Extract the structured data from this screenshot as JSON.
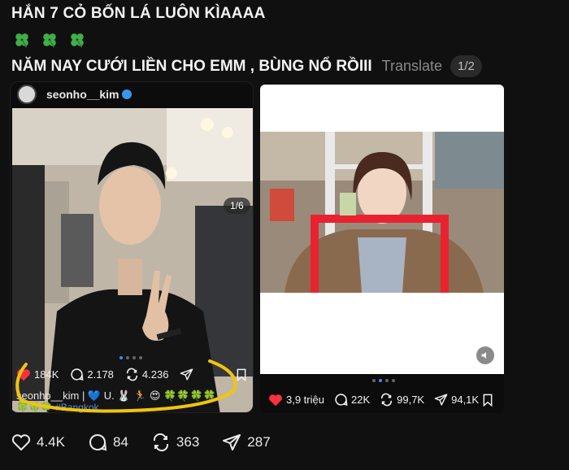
{
  "post": {
    "line1": "HẮN 7 CỎ BỐN LÁ LUÔN KÌAAAA",
    "line3": "NĂM NAY CƯỚI LIỀN CHO EMM , BÙNG NỔ RỒIII",
    "translate_label": "Translate",
    "media_counter": "1/2",
    "clover_icons": [
      "four-leaf-clover-icon",
      "four-leaf-clover-icon",
      "four-leaf-clover-icon"
    ]
  },
  "left_card": {
    "username": "seonho__kim",
    "photo_counter": "1/6",
    "likes": "184K",
    "comments": "2.178",
    "reposts": "4.236",
    "caption_line1": "seonho__kim | 💙 U. 🐰 🏃 😍 🍀🍀🍀🍀",
    "caption_line2_emoji": "🍀🍀🍀",
    "caption_hashtag": "#Bangkok"
  },
  "right_card": {
    "likes": "3,9 triệu",
    "comments": "22K",
    "reposts": "99,7K",
    "shares": "94,1K"
  },
  "bottom_bar": {
    "likes": "4.4K",
    "comments": "84",
    "reposts": "363",
    "shares": "287"
  },
  "colors": {
    "background": "#101010",
    "like_red": "#ff3040",
    "highlight_yellow": "#f1c40f",
    "link_blue": "#5f8fd6"
  }
}
